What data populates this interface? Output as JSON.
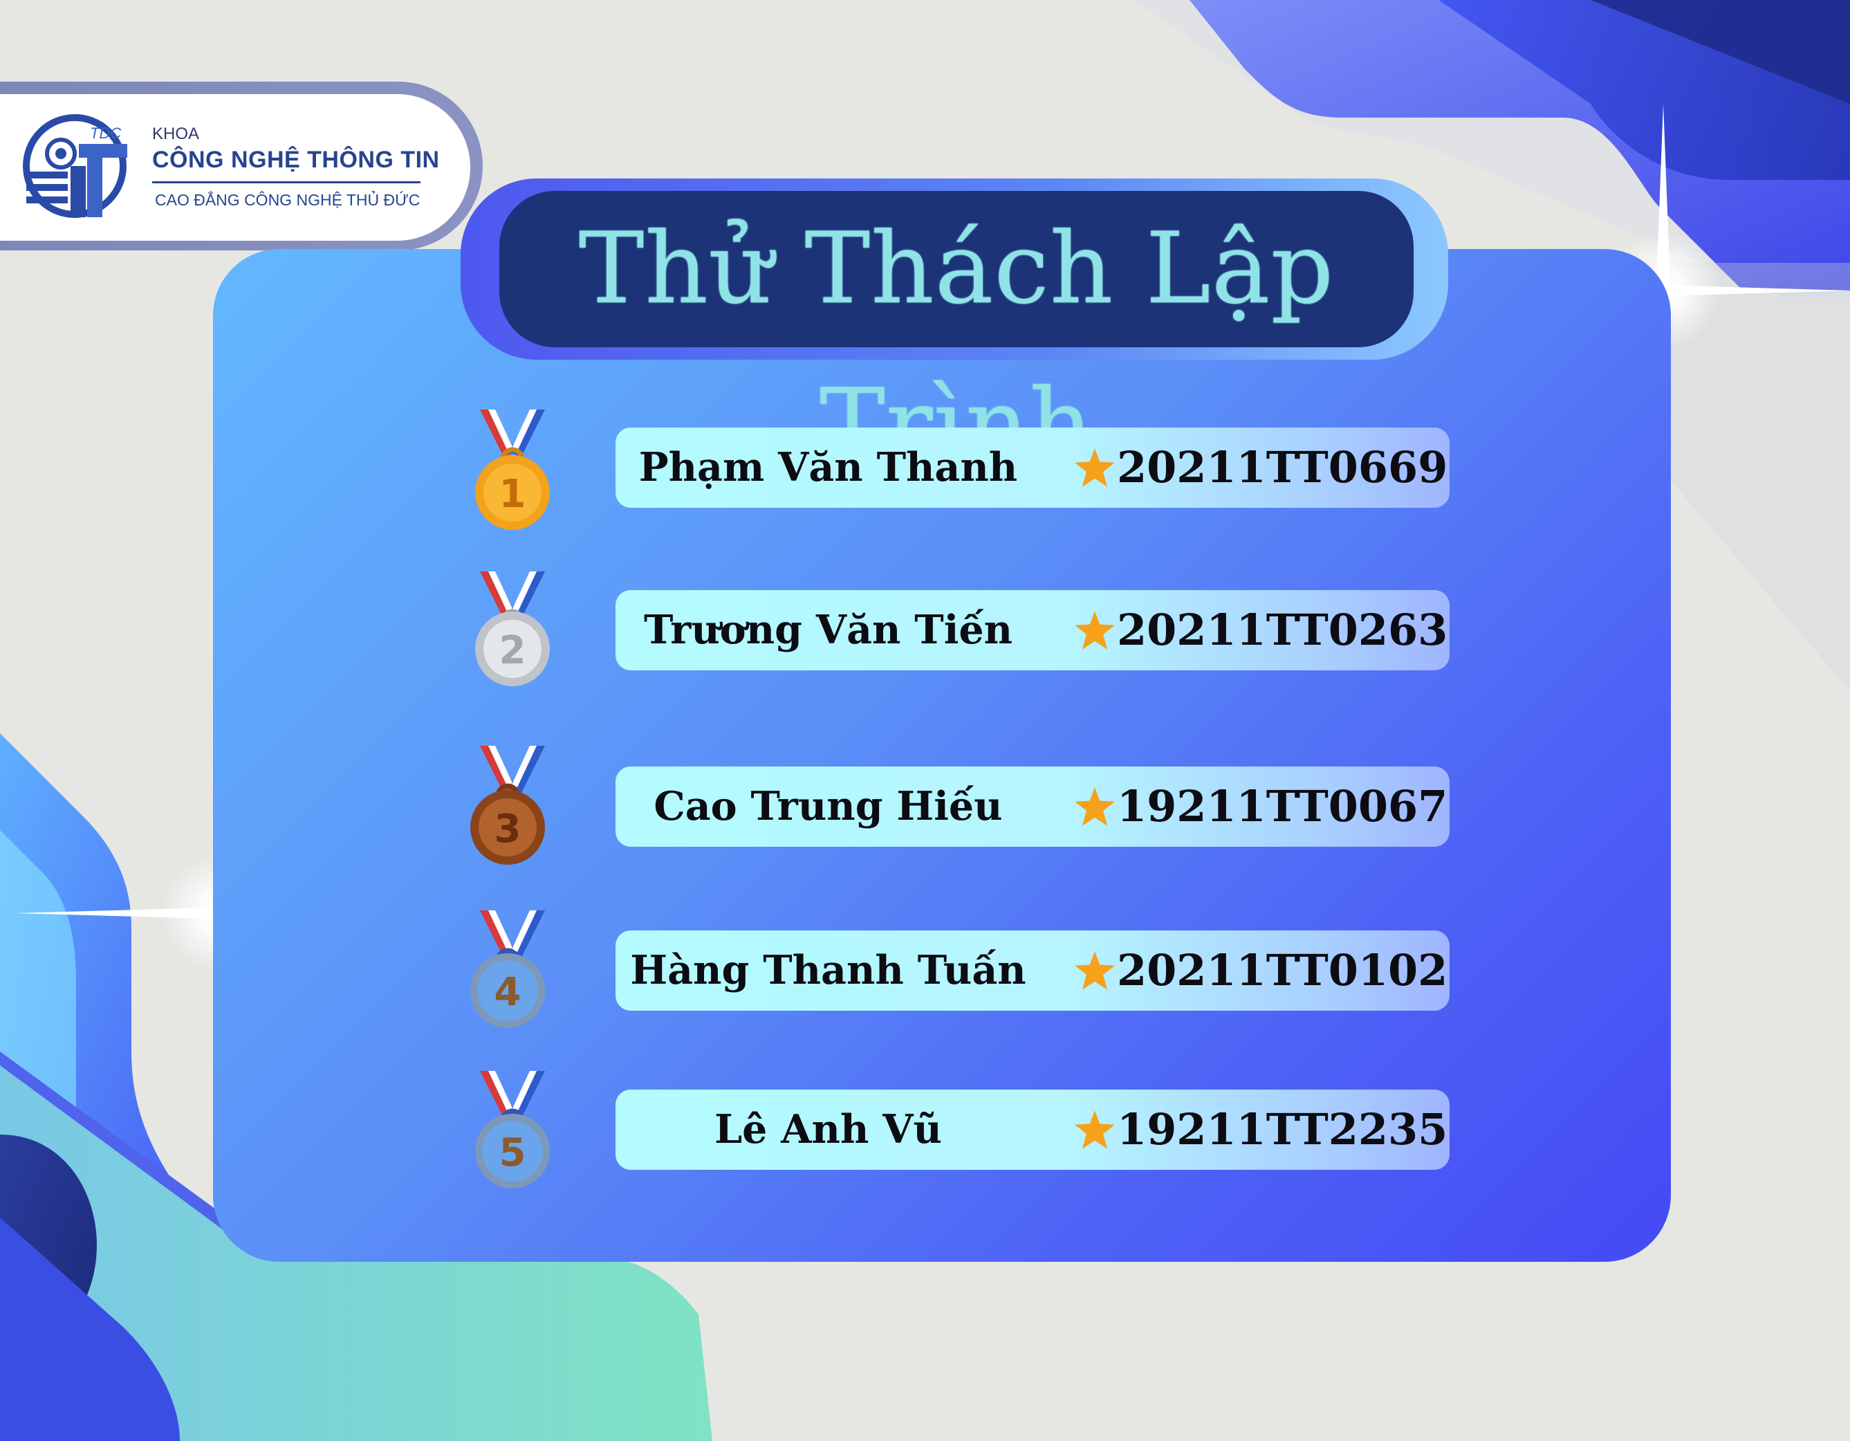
{
  "header": {
    "logo_tag": "TDC",
    "khoa": "KHOA",
    "department": "CÔNG NGHỆ THÔNG TIN",
    "school": "CAO ĐẲNG CÔNG NGHỆ THỦ ĐỨC"
  },
  "title": "Thử Thách Lập Trình",
  "rankings": [
    {
      "rank": "1",
      "medal": "gold-medal-icon",
      "name": "Phạm Văn Thanh",
      "code": "20211TT0669"
    },
    {
      "rank": "2",
      "medal": "silver-medal-icon",
      "name": "Trương Văn Tiến",
      "code": "20211TT0263"
    },
    {
      "rank": "3",
      "medal": "bronze-medal-icon",
      "name": "Cao Trung Hiếu",
      "code": "19211TT0067"
    },
    {
      "rank": "4",
      "medal": "blue-medal-icon",
      "name": "Hàng Thanh Tuấn",
      "code": "20211TT0102"
    },
    {
      "rank": "5",
      "medal": "blue-medal-icon",
      "name": "Lê Anh Vũ",
      "code": "19211TT2235"
    }
  ],
  "colors": {
    "background": "#e6e7e3",
    "panel_start": "#63b8ff",
    "panel_end": "#4549f4",
    "title_box": "#1c3378",
    "title_text": "#8fe3e6",
    "row": "#b3fbff",
    "star": "#f5a11a",
    "gold": "#f3a21b",
    "silver": "#c9cdd2",
    "bronze": "#9a4e21",
    "blue_medal": "#5b9be8"
  }
}
